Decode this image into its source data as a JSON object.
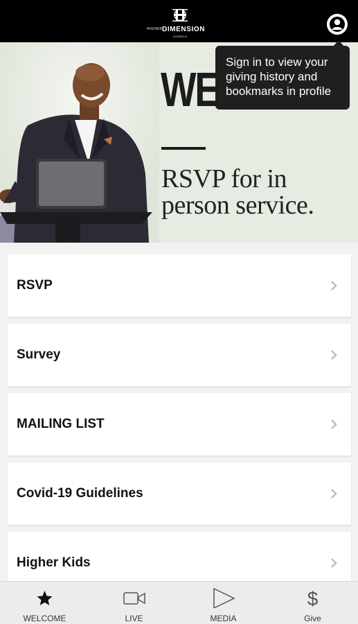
{
  "header": {
    "logo_small": "HIGHER",
    "logo_name": "DIMENSION",
    "logo_sub": "CHURCH",
    "profile_icon": "user-icon"
  },
  "hero": {
    "headline": "WE",
    "subtitle": "RSVP for in person service."
  },
  "tooltip": {
    "text": "Sign in to view your giving history and bookmarks in profile"
  },
  "list": {
    "items": [
      {
        "label": "RSVP"
      },
      {
        "label": "Survey"
      },
      {
        "label": "MAILING LIST"
      },
      {
        "label": "Covid-19 Guidelines"
      },
      {
        "label": "Higher Kids"
      }
    ]
  },
  "tabs": [
    {
      "label": "WELCOME",
      "icon": "star-icon"
    },
    {
      "label": "LIVE",
      "icon": "video-camera-icon"
    },
    {
      "label": "MEDIA",
      "icon": "play-icon"
    },
    {
      "label": "Give",
      "icon": "dollar-icon"
    }
  ],
  "colors": {
    "topbar": "#000000",
    "hero_bg": "#e7ece3",
    "tooltip_bg": "#1f1f1f",
    "tabbar_bg": "#ececec"
  }
}
